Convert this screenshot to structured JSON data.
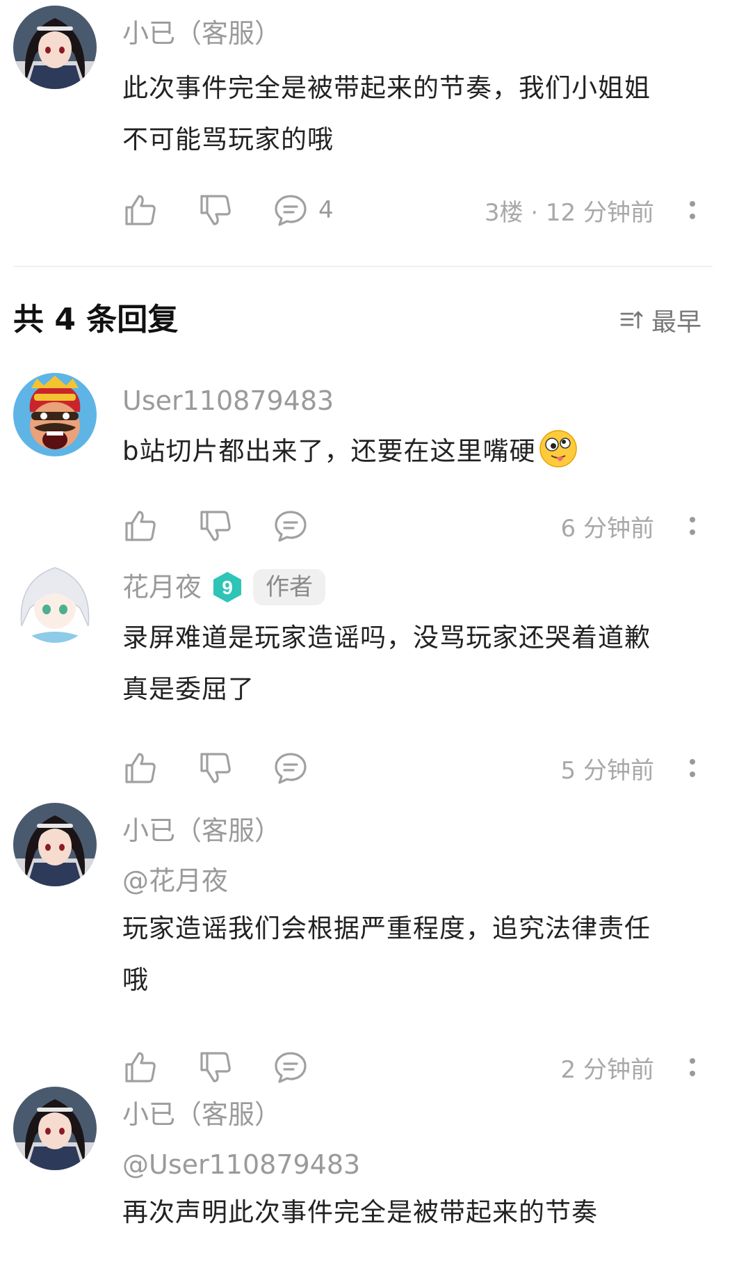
{
  "top_comment": {
    "username": "小已（客服）",
    "text_lines": [
      "此次事件完全是被带起来的节奏，我们小姐姐",
      "不可能骂玩家的哦"
    ],
    "reply_count": "4",
    "floor_time": "3楼 · 12 分钟前"
  },
  "replies_header": {
    "title": "共 4 条回复",
    "sort_label": "最早"
  },
  "replies": [
    {
      "username": "User110879483",
      "text": "b站切片都出来了，还要在这里嘴硬",
      "emoji": "crazy-face-emoji",
      "time": "6 分钟前"
    },
    {
      "username": "花月夜",
      "level": "9",
      "author_badge": "作者",
      "text_lines": [
        "录屏难道是玩家造谣吗，没骂玩家还哭着道歉",
        "真是委屈了"
      ],
      "time": "5 分钟前"
    },
    {
      "username": "小已（客服）",
      "mention": "@花月夜",
      "text_lines": [
        "玩家造谣我们会根据严重程度，追究法律责任",
        "哦"
      ],
      "time": "2 分钟前"
    },
    {
      "username": "小已（客服）",
      "mention": "@User110879483",
      "text_lines": [
        "再次声明此次事件完全是被带起来的节奏"
      ]
    }
  ],
  "icons": {
    "like": "thumbs-up-icon",
    "dislike": "thumbs-down-icon",
    "reply": "chat-bubble-icon",
    "more": "more-vertical-icon",
    "sort": "sort-icon"
  },
  "colors": {
    "level_badge": "#2ec4b6",
    "muted_text": "#9a9a9a",
    "body_text": "#222222"
  }
}
